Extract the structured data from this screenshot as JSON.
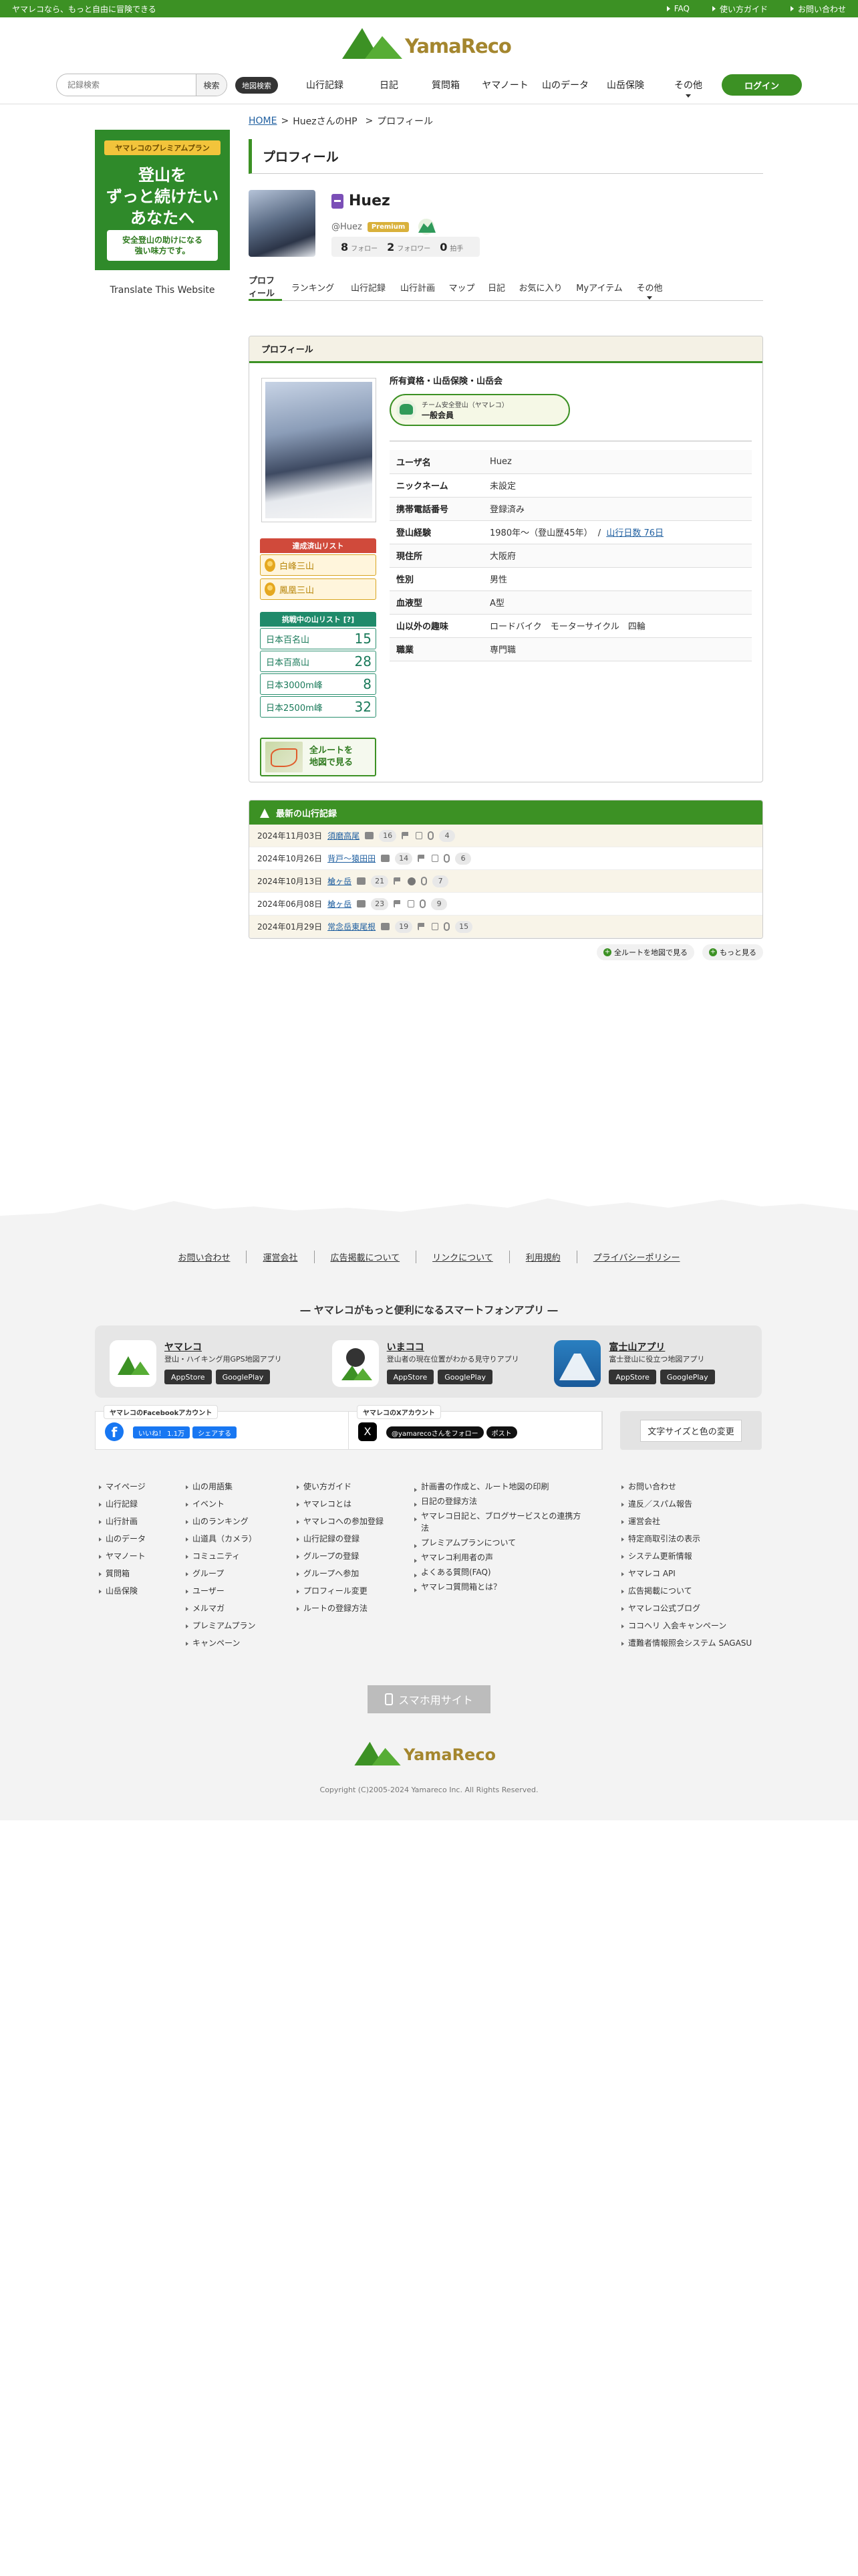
{
  "topbar": {
    "tagline": "ヤマレコなら、もっと自由に冒険できる",
    "links": [
      "FAQ",
      "使い方ガイド",
      "お問い合わせ"
    ]
  },
  "brand": {
    "name": "YamaReco",
    "green": "#3c9124",
    "gold": "#a4862e"
  },
  "nav": {
    "search_placeholder": "記録検索",
    "search_button": "検索",
    "map_search": "地図検索",
    "items": [
      "山行記録",
      "日記",
      "質問箱",
      "ヤマノート",
      "山のデータ",
      "山岳保険",
      "その他"
    ],
    "login": "ログイン"
  },
  "promo": {
    "ribbon": "ヤマレコのプレミアムプラン",
    "line1": "登山を",
    "line2": "ずっと続けたい",
    "line3": "あなたへ",
    "sub1": "安全登山の助けになる",
    "sub2": "強い味方です。"
  },
  "translate": "Translate This Website",
  "breadcrumb": {
    "home": "HOME",
    "hp": "HuezさんのHP",
    "current": "プロフィール",
    "sep": ">"
  },
  "page_title": "プロフィール",
  "user": {
    "name": "Huez",
    "id": "@Huez",
    "premium": "Premium",
    "follow_count": "8",
    "follow_label": "フォロー",
    "follower_count": "2",
    "follower_label": "フォロワー",
    "fan_count": "0",
    "fan_label": "拍手"
  },
  "tabs": [
    "プロフィール",
    "ランキング",
    "山行記録",
    "山行計画",
    "マップ",
    "日記",
    "お気に入り",
    "Myアイテム",
    "その他"
  ],
  "profile": {
    "header": "プロフィール",
    "qualification": "所有資格・山岳保険・山岳会",
    "member_line1": "チーム安全登山（ヤマレコ）",
    "member_line2": "一般会員",
    "summit_list_title": "達成済山リスト",
    "summits": [
      "白峰三山",
      "鳳凰三山"
    ],
    "challenge_title": "挑戦中の山リスト [?]",
    "challenges": [
      {
        "name": "日本百名山",
        "n": "15"
      },
      {
        "name": "日本百高山",
        "n": "28"
      },
      {
        "name": "日本3000m峰",
        "n": "8"
      },
      {
        "name": "日本2500m峰",
        "n": "32"
      }
    ],
    "all_route_1": "全ルートを",
    "all_route_2": "地図で見る",
    "rows": [
      {
        "k": "ユーザ名",
        "v": "Huez"
      },
      {
        "k": "ニックネーム",
        "v": "未設定"
      },
      {
        "k": "携帯電話番号",
        "v": "登録済み"
      },
      {
        "k": "登山経験",
        "v": "1980年〜（登山歴45年）",
        "link": "山行日数 76日",
        "sep": "/"
      },
      {
        "k": "現住所",
        "v": "大阪府"
      },
      {
        "k": "性別",
        "v": "男性"
      },
      {
        "k": "血液型",
        "v": "A型"
      },
      {
        "k": "山以外の趣味",
        "v": "ロードバイク　モーターサイクル　四輪"
      },
      {
        "k": "職業",
        "v": "専門職"
      }
    ]
  },
  "records": {
    "header": "最新の山行記録",
    "items": [
      {
        "date": "2024年11月03日",
        "name": "須磨高尾",
        "photos": "16",
        "comments": "4",
        "extra": ""
      },
      {
        "date": "2024年10月26日",
        "name": "背戸〜猿田田",
        "photos": "14",
        "comments": "6",
        "extra": ""
      },
      {
        "date": "2024年10月13日",
        "name": "槍ヶ岳",
        "photos": "21",
        "comments": "7",
        "extra": "star"
      },
      {
        "date": "2024年06月08日",
        "name": "槍ヶ岳",
        "photos": "23",
        "comments": "9",
        "extra": ""
      },
      {
        "date": "2024年01月29日",
        "name": "常念岳東尾根",
        "photos": "19",
        "comments": "15",
        "extra": ""
      }
    ],
    "all_route_btn": "全ルートを地図で見る",
    "more_btn": "もっと見る"
  },
  "footer": {
    "links": [
      "お問い合わせ",
      "運営会社",
      "広告掲載について",
      "リンクについて",
      "利用規約",
      "プライバシーポリシー"
    ],
    "app_title": "― ヤマレコがもっと便利になるスマートフォンアプリ ―",
    "apps": [
      {
        "name": "ヤマレコ",
        "desc": "登山・ハイキング用GPS地図アプリ",
        "b1": "AppStore",
        "b2": "GooglePlay"
      },
      {
        "name": "いまココ",
        "desc": "登山者の現在位置がわかる見守りアプリ",
        "b1": "AppStore",
        "b2": "GooglePlay"
      },
      {
        "name": "富士山アプリ",
        "desc": "富士登山に役立つ地図アプリ",
        "b1": "AppStore",
        "b2": "GooglePlay"
      }
    ],
    "fb_tag": "ヤマレコのFacebookアカウント",
    "fb_like": "いいね！ 1.1万",
    "fb_share": "シェアする",
    "x_tag": "ヤマレコのXアカウント",
    "x_follow": "@yamarecoさんをフォロー",
    "x_post": "ポスト",
    "font_size": "文字サイズと色の変更",
    "col1": [
      "マイページ",
      "山行記録",
      "山行計画",
      "山のデータ",
      "ヤマノート",
      "質問箱",
      "山岳保険"
    ],
    "col2": [
      "山の用語集",
      "イベント",
      "山のランキング",
      "山道具（カメラ）",
      "コミュニティ",
      "グループ",
      "ユーザー",
      "メルマガ",
      "プレミアムプラン",
      "キャンペーン"
    ],
    "col3_head": "使い方ガイド",
    "col3": [
      "ヤマレコとは",
      "ヤマレコへの参加登録",
      "山行記録の登録",
      "グループの登録",
      "グループへ参加",
      "プロフィール変更",
      "ルートの登録方法"
    ],
    "col4": [
      "計画書の作成と、ルート地図の印刷",
      "日記の登録方法",
      "ヤマレコ日記と、ブログサービスとの連携方法",
      "プレミアムプランについて",
      "ヤマレコ利用者の声",
      "よくある質問(FAQ)",
      "ヤマレコ質問箱とは？"
    ],
    "col5": [
      "お問い合わせ",
      "違反／スパム報告",
      "運営会社",
      "特定商取引法の表示",
      "システム更新情報",
      "ヤマレコ API",
      "広告掲載について",
      "ヤマレコ公式ブログ",
      "ココヘリ 入会キャンペーン",
      "遭難者情報照会システム SAGASU"
    ],
    "sp_site": "スマホ用サイト",
    "copyright": "Copyright (C)2005-2024 Yamareco Inc. All Rights Reserved."
  }
}
